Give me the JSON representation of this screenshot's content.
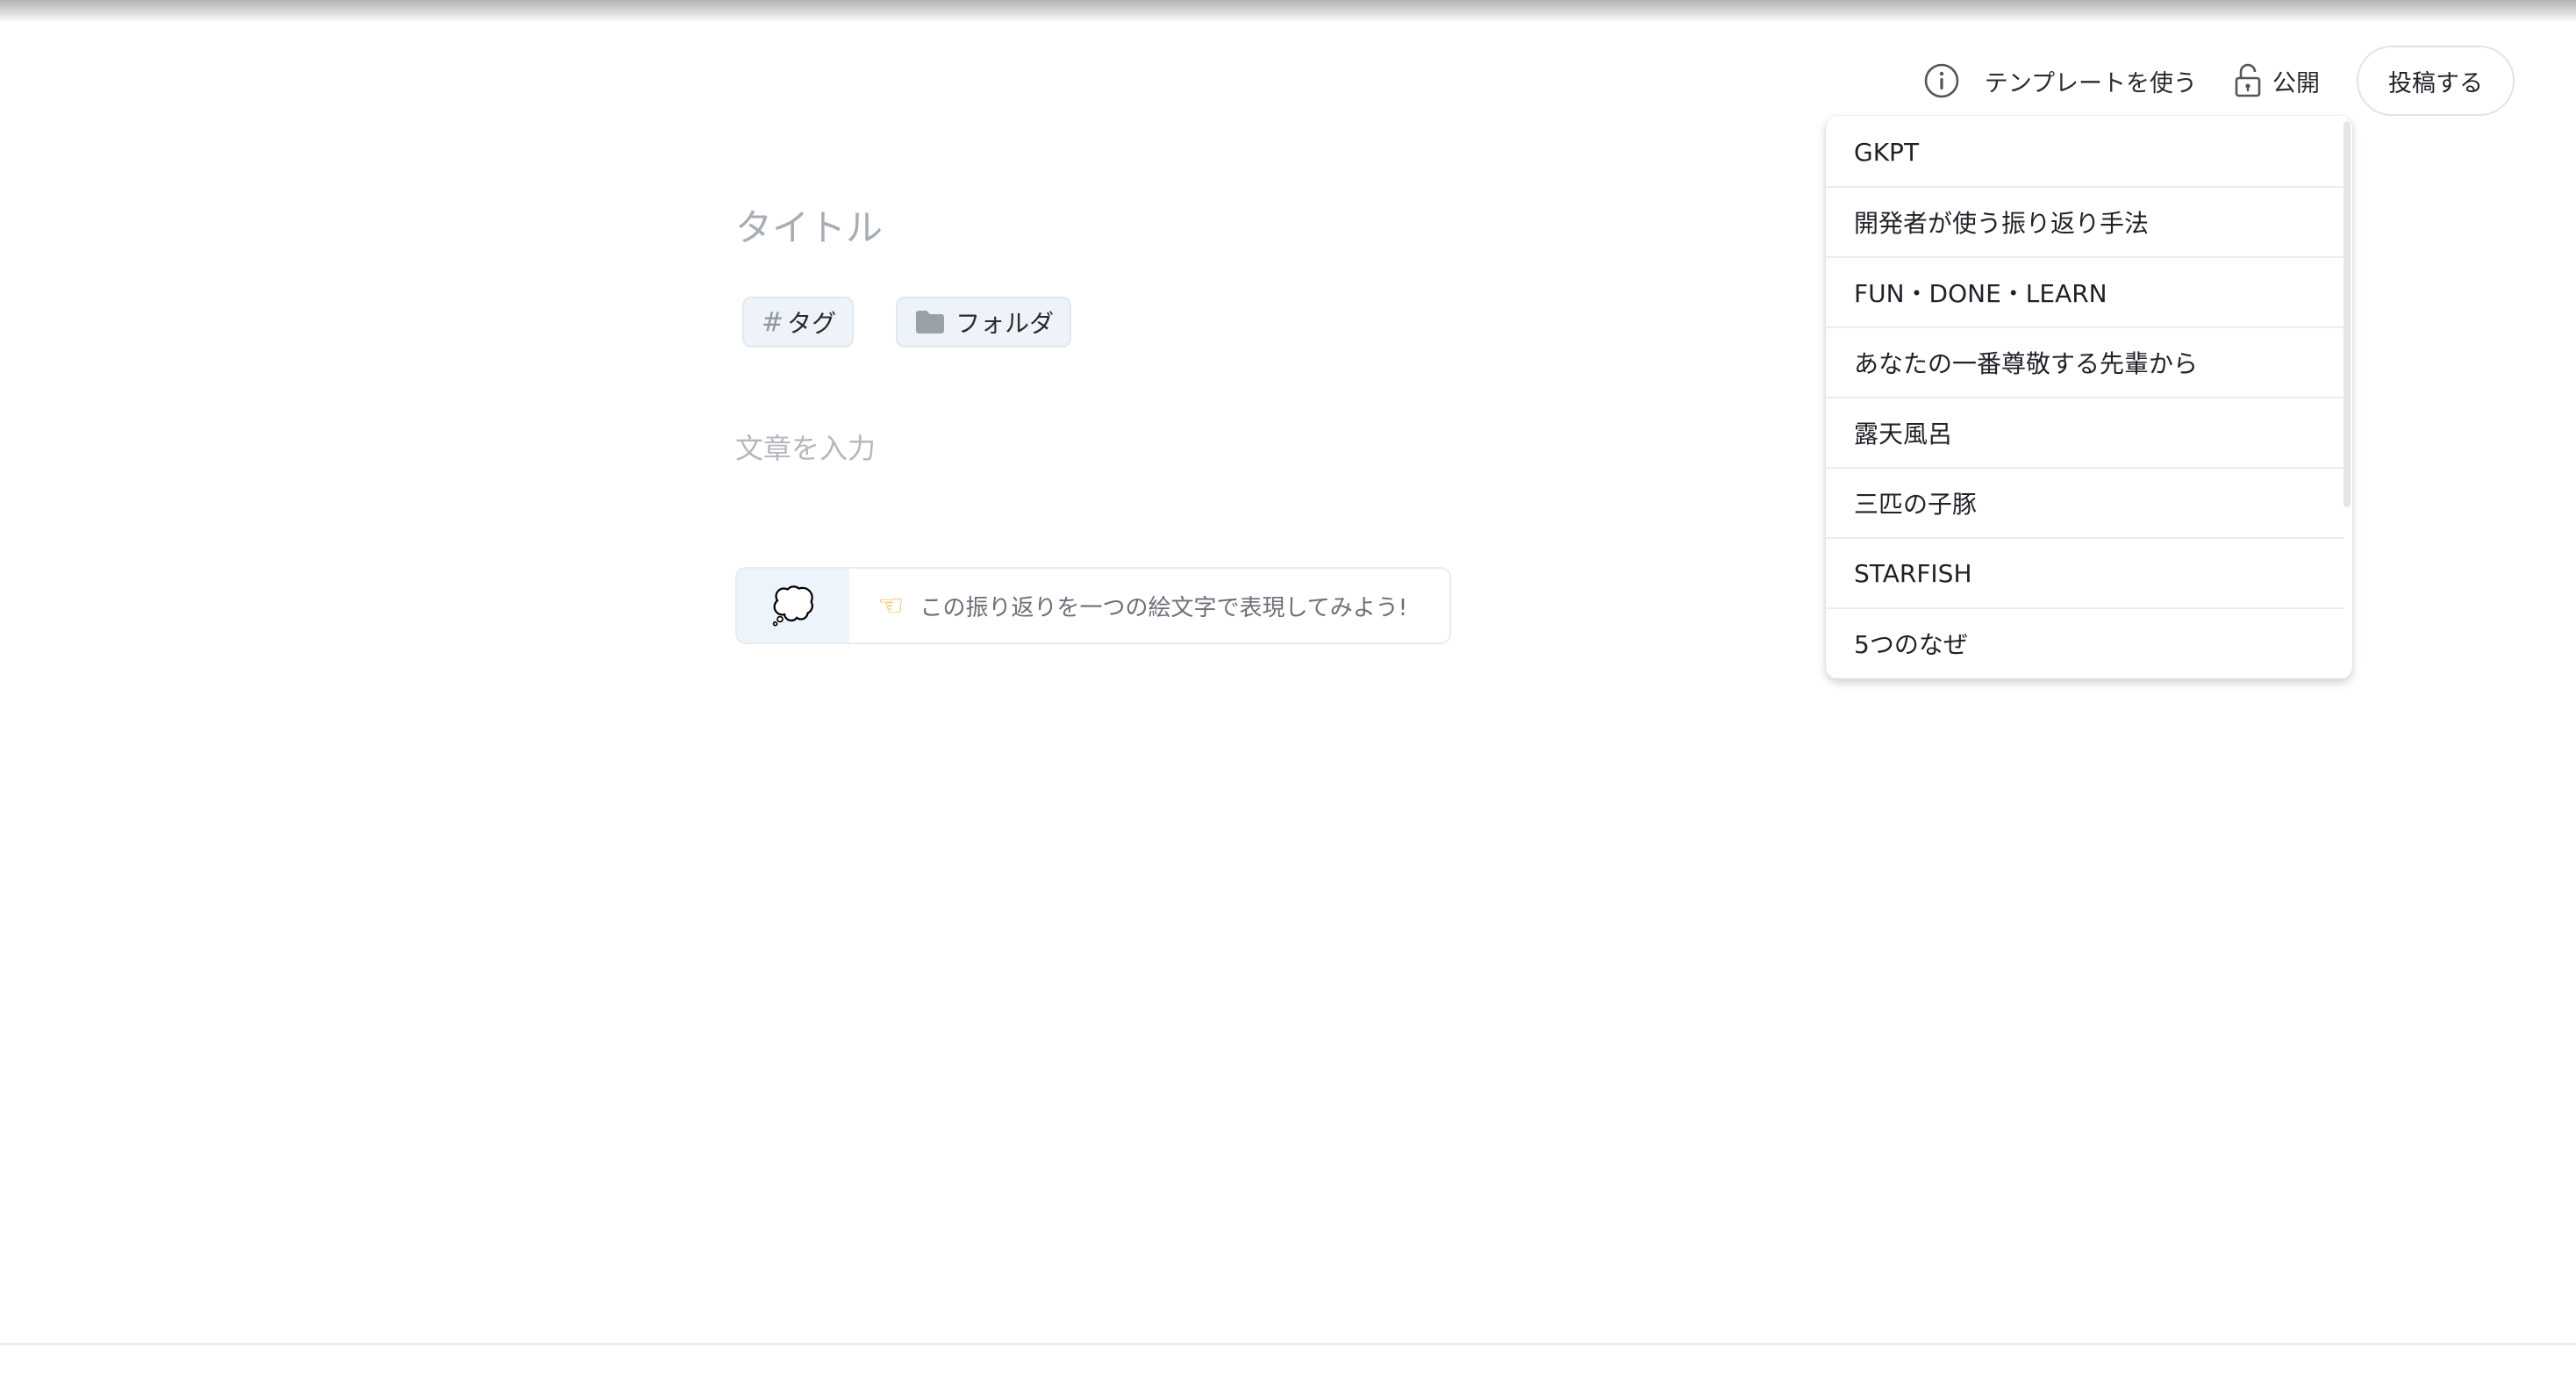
{
  "header": {
    "template_label": "テンプレートを使う",
    "visibility_label": "公開",
    "post_label": "投稿する"
  },
  "editor": {
    "title_placeholder": "タイトル",
    "tag_label": "タグ",
    "folder_label": "フォルダ",
    "body_placeholder": "文章を入力",
    "emoji_prompt": "この振り返りを一つの絵文字で表現してみよう!"
  },
  "template_menu": {
    "items": [
      "GKPT",
      "開発者が使う振り返り手法",
      "FUN・DONE・LEARN",
      "あなたの一番尊敬する先輩から",
      "露天風呂",
      "三匹の子豚",
      "STARFISH",
      "5つのなぜ"
    ]
  },
  "icons": {
    "info": "info-icon",
    "lock": "lock-open-icon",
    "hash": "hash-icon",
    "folder": "folder-icon",
    "emoji_placeholder": "thought-balloon-icon",
    "pointing": "backhand-index-pointing-left-icon"
  },
  "colors": {
    "placeholder": "#a8adb4",
    "chip_bg": "#eef3f9",
    "emoji_picker_bg": "#eef4fb"
  }
}
